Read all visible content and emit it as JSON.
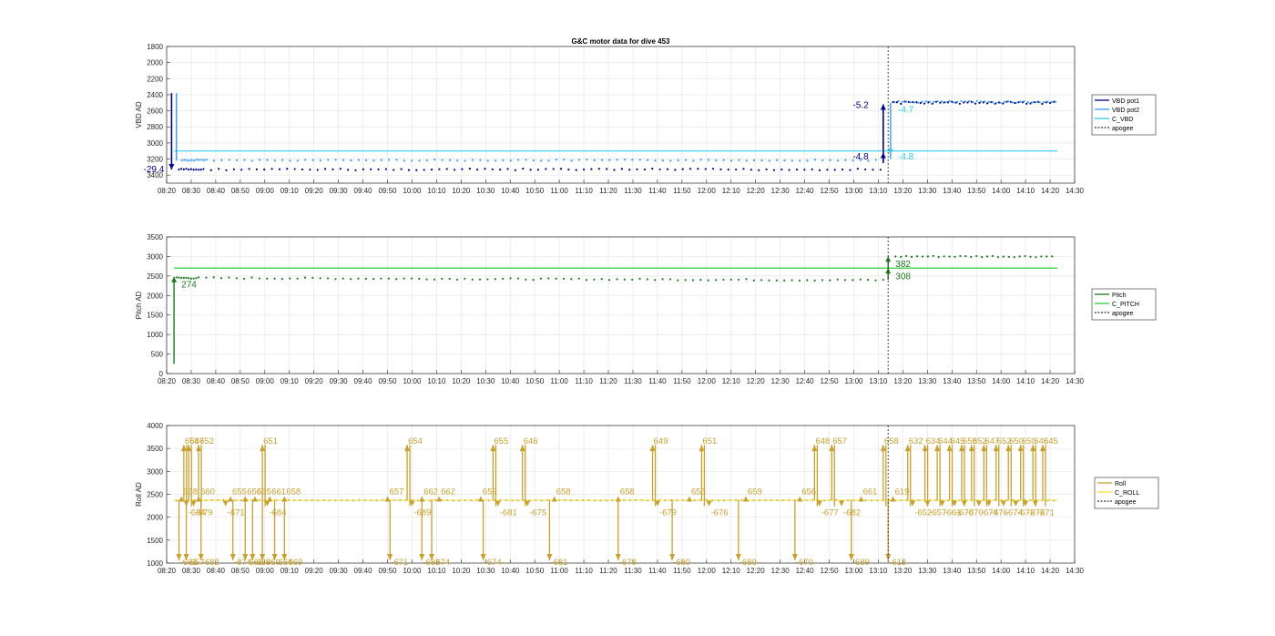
{
  "chart_data": [
    {
      "type": "line",
      "title": "G&C motor data for dive 453",
      "ylabel": "VBD AD",
      "ylim": [
        1800,
        3500
      ],
      "y_reversed": true,
      "xlim": [
        "08:20",
        "14:30"
      ],
      "yticks": [
        "1800",
        "2000",
        "2200",
        "2400",
        "2600",
        "2800",
        "3000",
        "3200",
        "3400"
      ],
      "xticks": [
        "08:20",
        "08:30",
        "08:40",
        "08:50",
        "09:00",
        "09:10",
        "09:20",
        "09:30",
        "09:40",
        "09:50",
        "10:00",
        "10:10",
        "10:20",
        "10:30",
        "10:40",
        "10:50",
        "11:00",
        "11:10",
        "11:20",
        "11:30",
        "11:40",
        "11:50",
        "12:00",
        "12:10",
        "12:20",
        "12:30",
        "12:40",
        "12:50",
        "13:00",
        "13:10",
        "13:20",
        "13:30",
        "13:40",
        "13:50",
        "14:00",
        "14:10",
        "14:20",
        "14:30"
      ],
      "grid": true,
      "legend_position": "outside-right",
      "legend": [
        "VBD pot1",
        "VBD pot2",
        "C_VBD",
        "apogee"
      ],
      "colors": {
        "pot1": "#00008b",
        "pot2": "#3399ff",
        "c_vbd": "#33ccee",
        "apogee": "#333333"
      },
      "c_vbd": 3100,
      "apogee_x": "13:14",
      "annotations": [
        {
          "text": "-29.4",
          "x": "08:19",
          "y": 3330
        },
        {
          "text": "-5.2",
          "x": "13:06",
          "y": 2530
        },
        {
          "text": "-4.7",
          "x": "13:18",
          "y": 2590
        },
        {
          "text": "-4.8",
          "x": "13:06",
          "y": 3170
        },
        {
          "text": "-4.8",
          "x": "13:18",
          "y": 3170
        }
      ]
    },
    {
      "type": "line",
      "ylabel": "Pitch AD",
      "ylim": [
        0,
        3500
      ],
      "xlim": [
        "08:20",
        "14:30"
      ],
      "yticks": [
        "0",
        "500",
        "1000",
        "1500",
        "2000",
        "2500",
        "3000",
        "3500"
      ],
      "grid": true,
      "legend_position": "outside-right",
      "legend": [
        "Pitch",
        "C_PITCH",
        "apogee"
      ],
      "colors": {
        "pitch": "#1e7a1e",
        "c_pitch": "#33cc33",
        "apogee": "#333333"
      },
      "c_pitch": 2700,
      "apogee_x": "13:14",
      "annotations": [
        {
          "text": "274",
          "x": "08:26",
          "y": 2270
        },
        {
          "text": "382",
          "x": "13:17",
          "y": 2800
        },
        {
          "text": "308",
          "x": "13:17",
          "y": 2480
        }
      ]
    },
    {
      "type": "line",
      "ylabel": "Roll AD",
      "ylim": [
        1000,
        4000
      ],
      "xlim": [
        "08:20",
        "14:30"
      ],
      "yticks": [
        "1000",
        "1500",
        "2000",
        "2500",
        "3000",
        "3500",
        "4000"
      ],
      "grid": true,
      "legend_position": "outside-right",
      "legend": [
        "Roll",
        "C_ROLL",
        "apogee"
      ],
      "colors": {
        "roll": "#c8a030",
        "c_roll": "#f0e040",
        "apogee": "#333333"
      },
      "c_roll": 2370,
      "apogee_x": "13:14",
      "up_labels": [
        {
          "x": "08:27",
          "text": "656"
        },
        {
          "x": "08:29",
          "text": "647"
        },
        {
          "x": "08:33",
          "text": "652"
        },
        {
          "x": "08:59",
          "text": "651"
        },
        {
          "x": "09:58",
          "text": "654"
        },
        {
          "x": "10:33",
          "text": "655"
        },
        {
          "x": "10:45",
          "text": "646"
        },
        {
          "x": "11:38",
          "text": "649"
        },
        {
          "x": "11:58",
          "text": "651"
        },
        {
          "x": "12:44",
          "text": "648"
        },
        {
          "x": "12:51",
          "text": "657"
        },
        {
          "x": "13:12",
          "text": "658"
        },
        {
          "x": "13:22",
          "text": "632"
        },
        {
          "x": "13:29",
          "text": "634"
        },
        {
          "x": "13:34",
          "text": "644"
        },
        {
          "x": "13:39",
          "text": "645"
        },
        {
          "x": "13:44",
          "text": "658"
        },
        {
          "x": "13:48",
          "text": "652"
        },
        {
          "x": "13:53",
          "text": "647"
        },
        {
          "x": "13:58",
          "text": "652"
        },
        {
          "x": "14:03",
          "text": "650"
        },
        {
          "x": "14:08",
          "text": "650"
        },
        {
          "x": "14:13",
          "text": "646"
        },
        {
          "x": "14:17",
          "text": "645"
        }
      ],
      "mid_labels": [
        {
          "x": "08:26",
          "text": "658"
        },
        {
          "x": "08:33",
          "text": "660"
        },
        {
          "x": "08:46",
          "text": "655"
        },
        {
          "x": "08:52",
          "text": "656"
        },
        {
          "x": "08:56",
          "text": "665"
        },
        {
          "x": "09:02",
          "text": "661"
        },
        {
          "x": "09:08",
          "text": "658"
        },
        {
          "x": "09:50",
          "text": "657"
        },
        {
          "x": "10:04",
          "text": "662"
        },
        {
          "x": "10:11",
          "text": "662"
        },
        {
          "x": "10:28",
          "text": "659"
        },
        {
          "x": "10:58",
          "text": "658"
        },
        {
          "x": "11:24",
          "text": "658"
        },
        {
          "x": "11:53",
          "text": "655"
        },
        {
          "x": "12:16",
          "text": "659"
        },
        {
          "x": "12:38",
          "text": "656"
        },
        {
          "x": "13:03",
          "text": "661"
        },
        {
          "x": "13:16",
          "text": "619"
        }
      ],
      "low_labels": [
        {
          "x": "08:28",
          "text": "-684"
        },
        {
          "x": "08:31",
          "text": "-679"
        },
        {
          "x": "08:44",
          "text": "-671"
        },
        {
          "x": "09:01",
          "text": "-684"
        },
        {
          "x": "10:00",
          "text": "-689"
        },
        {
          "x": "10:35",
          "text": "-681"
        },
        {
          "x": "10:47",
          "text": "-675"
        },
        {
          "x": "11:40",
          "text": "-679"
        },
        {
          "x": "12:01",
          "text": "-676"
        },
        {
          "x": "12:46",
          "text": "-677"
        },
        {
          "x": "12:55",
          "text": "-682"
        },
        {
          "x": "13:24",
          "text": "-652"
        },
        {
          "x": "13:30",
          "text": "-657"
        },
        {
          "x": "13:36",
          "text": "-661"
        },
        {
          "x": "13:41",
          "text": "-670"
        },
        {
          "x": "13:45",
          "text": "-670"
        },
        {
          "x": "13:51",
          "text": "-674"
        },
        {
          "x": "13:55",
          "text": "-676"
        },
        {
          "x": "14:01",
          "text": "-674"
        },
        {
          "x": "14:06",
          "text": "-672"
        },
        {
          "x": "14:10",
          "text": "-672"
        },
        {
          "x": "14:14",
          "text": "-671"
        }
      ],
      "bottom_labels": [
        {
          "x": "08:25",
          "text": "-661"
        },
        {
          "x": "08:28",
          "text": "-657"
        },
        {
          "x": "08:34",
          "text": "-682"
        },
        {
          "x": "08:47",
          "text": "-674"
        },
        {
          "x": "08:52",
          "text": "-668"
        },
        {
          "x": "08:55",
          "text": "-669"
        },
        {
          "x": "08:59",
          "text": "-669"
        },
        {
          "x": "09:04",
          "text": "-664"
        },
        {
          "x": "09:08",
          "text": "-669"
        },
        {
          "x": "09:51",
          "text": "-671"
        },
        {
          "x": "10:04",
          "text": "-683"
        },
        {
          "x": "10:08",
          "text": "-674"
        },
        {
          "x": "10:29",
          "text": "-674"
        },
        {
          "x": "10:56",
          "text": "-681"
        },
        {
          "x": "11:24",
          "text": "-678"
        },
        {
          "x": "11:46",
          "text": "-680"
        },
        {
          "x": "12:13",
          "text": "-680"
        },
        {
          "x": "12:36",
          "text": "-670"
        },
        {
          "x": "12:59",
          "text": "-689"
        },
        {
          "x": "13:14",
          "text": "-613"
        }
      ]
    }
  ]
}
